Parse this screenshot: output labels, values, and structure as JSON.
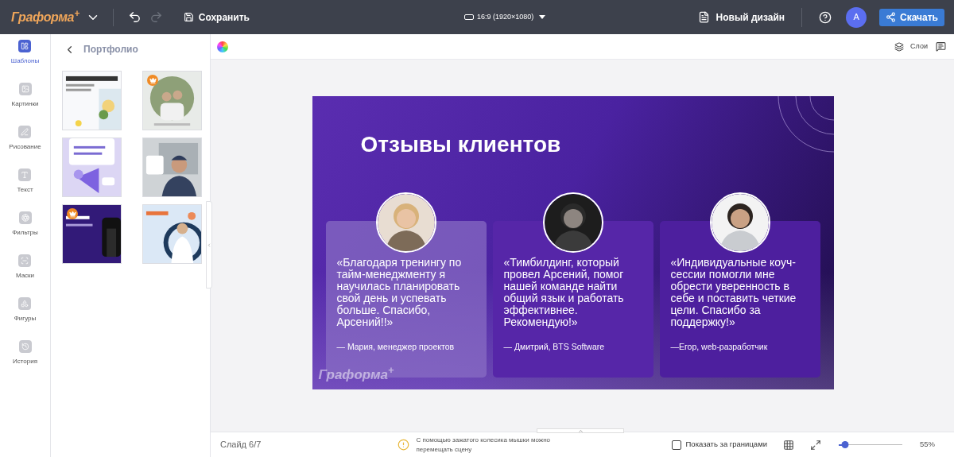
{
  "topbar": {
    "logo": "Граформа$^{+}$",
    "save": "Сохранить",
    "format": "16:9 (1920×1080)",
    "new_design": "Новый дизайн",
    "avatar": "A",
    "download": "Скачать"
  },
  "rail": [
    {
      "label": "Шаблоны",
      "selected": true
    },
    {
      "label": "Картинки",
      "selected": false
    },
    {
      "label": "Рисование",
      "selected": false
    },
    {
      "label": "Текст",
      "selected": false
    },
    {
      "label": "Фильтры",
      "selected": false
    },
    {
      "label": "Маски",
      "selected": false
    },
    {
      "label": "Фигуры",
      "selected": false
    },
    {
      "label": "История",
      "selected": false
    }
  ],
  "panel": {
    "title": "Портфолио",
    "templates": [
      {
        "kind": "picture",
        "premium": false
      },
      {
        "kind": "picture",
        "premium": true
      },
      {
        "kind": "picture",
        "premium": false
      },
      {
        "kind": "picture",
        "premium": false
      },
      {
        "kind": "picture",
        "premium": true
      },
      {
        "kind": "picture",
        "premium": false
      }
    ]
  },
  "canvas_toolbar": {
    "layers": "Слои"
  },
  "slide": {
    "title": "Отзывы клиентов",
    "watermark": "Граформа$^{+}$",
    "testimonials": [
      {
        "quote": "«Благодаря тренингу по тайм-менеджменту я научилась планировать свой день и успевать больше. Спасибо, Арсений!!»",
        "author": "— Мария, менеджер проектов"
      },
      {
        "quote": "«Тимбилдинг, который провел Арсений, помог нашей команде найти общий язык и работать эффективнее. Рекомендую!»",
        "author": "— Дмитрий, BTS Software"
      },
      {
        "quote": "«Индивидуальные коуч-сессии помогли мне обрести уверенность в себе и поставить четкие цели. Спасибо за поддержку!»",
        "author": "—Егор, web-разработчик"
      }
    ]
  },
  "status_bar": {
    "slide": "Слайд 6/7",
    "hint": "С помощью зажатого колесика мышки можно перемещать сцену",
    "show_outside": {
      "label": "Показать за границами",
      "checked": false
    },
    "zoom": {
      "level": 0.1,
      "reading": "55%"
    }
  }
}
